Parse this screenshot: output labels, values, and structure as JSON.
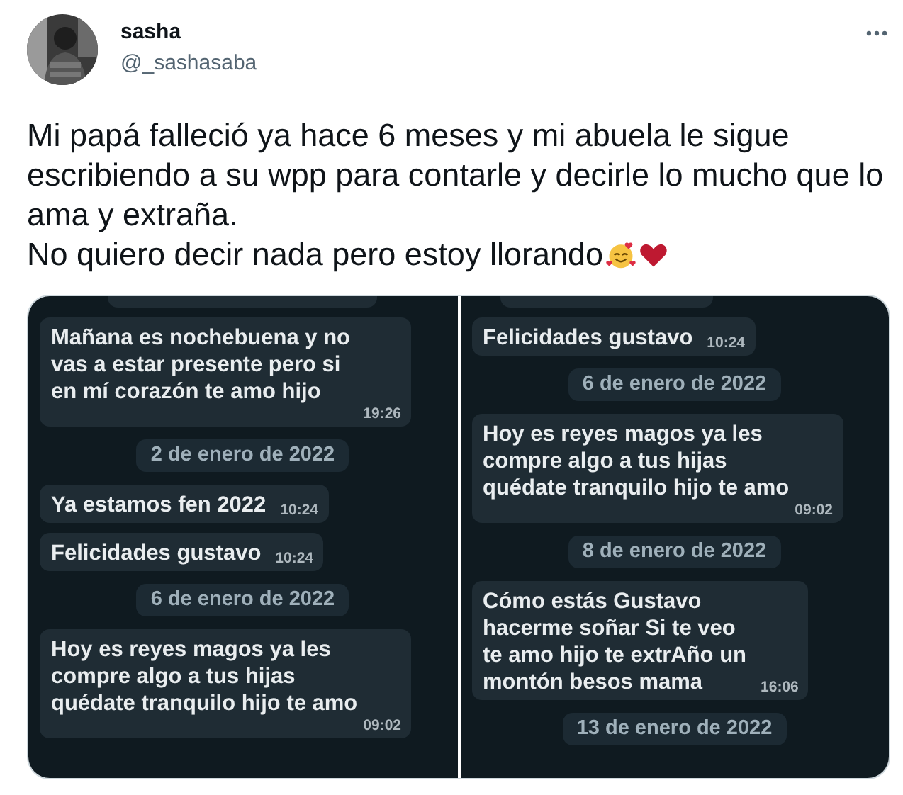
{
  "author": {
    "name": "sasha",
    "handle": "@_sashasaba"
  },
  "tweet": {
    "lines": [
      "Mi papá falleció ya hace 6 meses y mi abuela le sigue escribiendo a su wpp para contarle y decirle lo mucho que lo ama y extraña.",
      "No quiero decir nada pero estoy llorando"
    ]
  },
  "media": [
    {
      "items": [
        {
          "kind": "cut"
        },
        {
          "kind": "message",
          "text": "Mañana es nochebuena y no\nvas a estar presente pero si\nen mí corazón te amo hijo",
          "time": "19:26"
        },
        {
          "kind": "date",
          "text": "2 de enero de 2022"
        },
        {
          "kind": "message",
          "text": "Ya estamos fen 2022",
          "time": "10:24"
        },
        {
          "kind": "message",
          "text": "Felicidades gustavo",
          "time": "10:24"
        },
        {
          "kind": "date",
          "text": "6 de enero de 2022"
        },
        {
          "kind": "message",
          "text": "Hoy es reyes magos ya les\ncompre algo a tus hijas\nquédate tranquilo hijo te amo",
          "time": "09:02"
        }
      ]
    },
    {
      "items": [
        {
          "kind": "cut"
        },
        {
          "kind": "message",
          "text": "Felicidades gustavo",
          "time": "10:24"
        },
        {
          "kind": "date",
          "text": "6 de enero de 2022"
        },
        {
          "kind": "message",
          "text": "Hoy es reyes magos ya les\ncompre algo a tus hijas\nquédate tranquilo hijo te amo",
          "time": "09:02"
        },
        {
          "kind": "date",
          "text": "8 de enero de 2022"
        },
        {
          "kind": "message",
          "text": "Cómo estás Gustavo\nhacerme soñar Si te veo\nte amo hijo te extrAño un\nmontón besos mama",
          "time": "16:06"
        },
        {
          "kind": "date",
          "text": "13 de enero de 2022"
        }
      ]
    }
  ]
}
